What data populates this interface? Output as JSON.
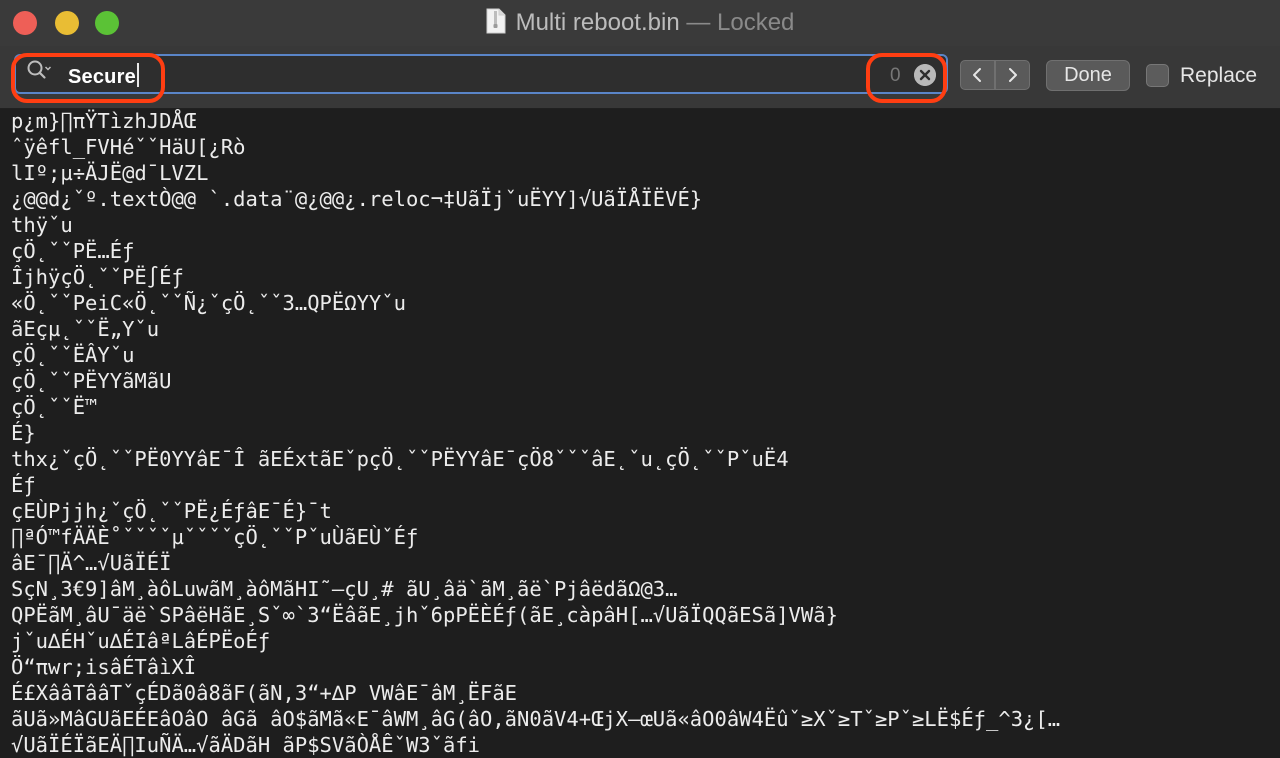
{
  "window": {
    "title": "Multi reboot.bin",
    "separator": "—",
    "status": "Locked"
  },
  "find": {
    "query": "Secure",
    "match_count": "0",
    "done_label": "Done",
    "replace_label": "Replace",
    "icons": {
      "search": "search-icon",
      "clear": "clear-icon",
      "prev": "chevron-left-icon",
      "next": "chevron-right-icon"
    },
    "highlight_color": "#ff3e12"
  },
  "content": {
    "lines": [
      "p¿m}∏πŸTìzhJDÅŒ",
      "ˆÿêfl_FVHéˇˇHäU[¿Rò",
      "lIº;µ÷ÄJË@d¯LVZL",
      "¿@@d¿ˇº.textÒ@@ `.data¨@¿@@¿.reloc¬‡UãÏjˇuËYY]√UãÏÅÏËVÉ}",
      "thÿˇu",
      "çÖ˛ˇˇPË…Éƒ",
      "ÎjhÿçÖ˛ˇˇPË∫Éƒ",
      "«Ö˛ˇˇPeiC«Ö˛ˇˇÑ¿ˇçÖ˛ˇˇ3…QPËΩYYˇu",
      "ãEçµ˛ˇˇË„Yˇu",
      "çÖ˛ˇˇËÂYˇu",
      "çÖ˛ˇˇPËYYãMãU",
      "çÖ˛ˇˇË™",
      "É}",
      "thx¿ˇçÖ˛ˇˇPË0YYâE¯Î ãEÉxtãEˇpçÖ˛ˇˇPËYYâE¯çÖ8ˇˇˇâE˛ˇu˛çÖ˛ˇˇPˇuË4",
      "Éƒ",
      "çEÙPjjh¿ˇçÖ˛ˇˇPË¿ÉƒâE¯É}¯t",
      "∏ªÓ™fÄÄÈ˚ˇˇˇˇµˇˇˇˇçÖ˛ˇˇPˇuÙãEÙˇÉƒ",
      "âE¯∏Ä^…√UãÏÉÏ",
      "SçN¸3€9]âM¸àôLuwãM¸àôMãHI˜—çU¸# ãU¸âä`ãM¸ãë`PjâëdãΩ@3…",
      "QPËãM¸âU¯äë`SPâëHãE¸Sˇ∞`3“ËâãE¸jhˇ6pPËÈÉƒ(ãE¸càpâH[…√UãÏQQãESã]VWã}",
      "jˇu∆ÉHˇu∆ÉIâªLâÉPËoÉƒ",
      "Ö“πwr;isâÉTâìXÎ",
      "É£XââTââTˇçÉDã0â8ãF(ãN,3“+∆P VWâE¯âM¸ËFãE",
      "ãUã»MâGUãEÉEâOâO âGã âO$ãMã«E¯âWM¸âG(âO,ãN0ãV4+ŒjX—œUã«âO0âW4Ëûˇ≥Xˇ≥Tˇ≥Pˇ≥LË$Éƒ_^3¿[…",
      "√UãÏÉÏãEÄ∏IuÑÄ…√ãÄDãH ãP$SVãÒÅÊˇW3ˇãfi"
    ]
  }
}
